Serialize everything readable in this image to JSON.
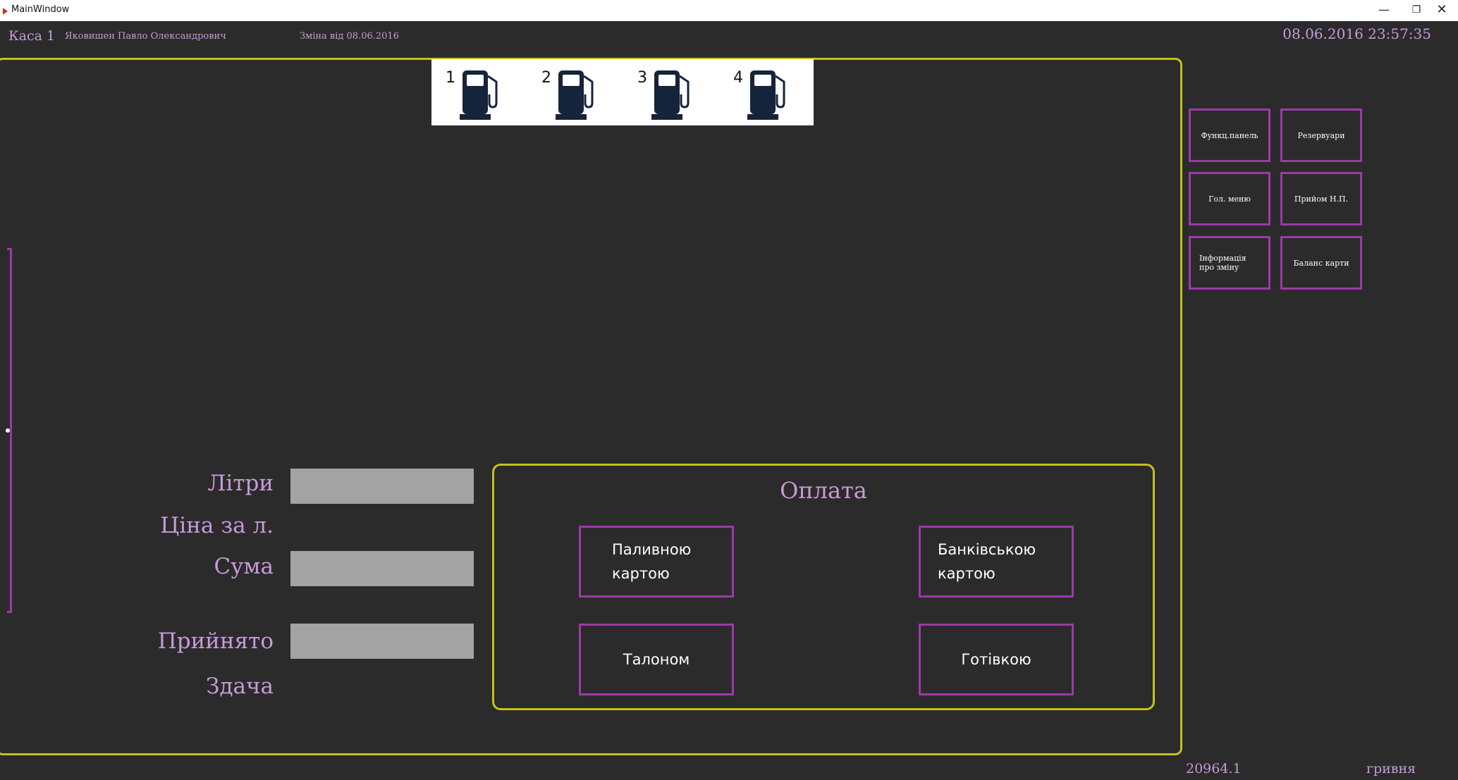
{
  "window": {
    "title": "MainWindow",
    "minimize": "—",
    "maximize": "❐",
    "close": "✕"
  },
  "header": {
    "kasa": "Каса 1",
    "cashier": "Яковишен Павло Олександрович",
    "shift": "Зміна від  08.06.2016",
    "datetime": "08.06.2016  23:57:35"
  },
  "pumps": [
    {
      "number": "1"
    },
    {
      "number": "2"
    },
    {
      "number": "3"
    },
    {
      "number": "4"
    }
  ],
  "fields": {
    "litres_label": "Літри",
    "litres_value": "",
    "price_label": "Ціна за л.",
    "sum_label": "Сума",
    "sum_value": "",
    "accepted_label": "Прийнято",
    "accepted_value": "",
    "change_label": "Здача"
  },
  "payment": {
    "title": "Оплата",
    "fuel_card": [
      "Паливною",
      "картою"
    ],
    "bank_card": [
      "Банківською",
      "картою"
    ],
    "coupon": "Талоном",
    "cash": "Готівкою"
  },
  "side_buttons": {
    "func_panel": "Функц.панель",
    "reservoirs": "Резервуари",
    "main_menu": "Гол. меню",
    "receive": "Прийом Н.П.",
    "shift_info": [
      "Інформація",
      "про зміну"
    ],
    "card_balance": "Баланс карти"
  },
  "footer": {
    "amount": "20964.1",
    "currency": "гривня"
  },
  "colors": {
    "background": "#2b2b2b",
    "accent_yellow": "#c4c21a",
    "accent_purple": "#9b3aa8",
    "label_lilac": "#c79bd8",
    "input_gray": "#a3a3a3",
    "pump_navy": "#14243a"
  }
}
